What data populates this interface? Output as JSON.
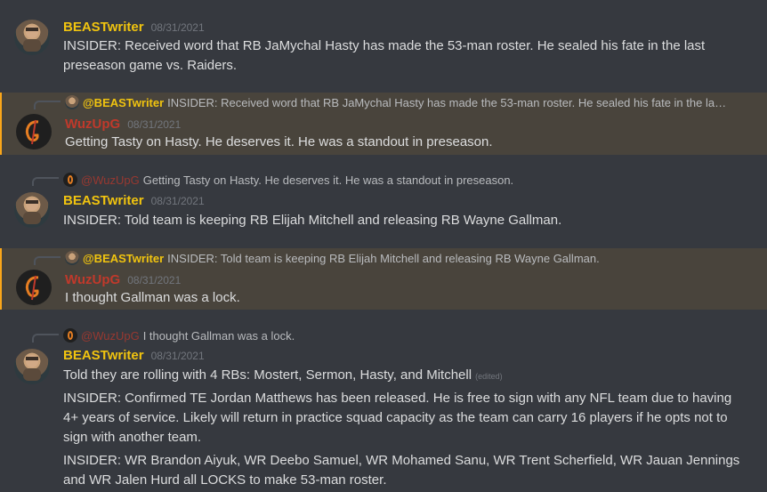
{
  "colors": {
    "background": "#36393f",
    "highlight": "#49443c",
    "highlight_border": "#faa61a",
    "beast_name": "#f1c40f",
    "wuz_name": "#c0392b",
    "timestamp": "#72767d"
  },
  "messages": [
    {
      "author": "BEASTwriter",
      "timestamp": "08/31/2021",
      "lines": [
        "INSIDER: Received word that RB JaMychal Hasty has made the 53-man roster. He sealed his fate in the last preseason game vs. Raiders."
      ]
    },
    {
      "reply_to": {
        "author": "@BEASTwriter",
        "text": "INSIDER: Received word that RB JaMychal Hasty has made the 53-man roster. He sealed his fate in the last p..."
      },
      "author": "WuzUpG",
      "timestamp": "08/31/2021",
      "lines": [
        "Getting Tasty on Hasty. He deserves it. He was a standout in preseason."
      ]
    },
    {
      "reply_to": {
        "author": "@WuzUpG",
        "text": "Getting Tasty on Hasty. He deserves it. He was a standout in preseason."
      },
      "author": "BEASTwriter",
      "timestamp": "08/31/2021",
      "lines": [
        "INSIDER: Told team is keeping RB Elijah Mitchell and releasing RB Wayne Gallman."
      ]
    },
    {
      "reply_to": {
        "author": "@BEASTwriter",
        "text": "INSIDER: Told team is keeping RB Elijah Mitchell and releasing RB Wayne Gallman."
      },
      "author": "WuzUpG",
      "timestamp": "08/31/2021",
      "lines": [
        "I thought Gallman was a lock."
      ]
    },
    {
      "reply_to": {
        "author": "@WuzUpG",
        "text": "I thought Gallman was a lock."
      },
      "author": "BEASTwriter",
      "timestamp": "08/31/2021",
      "lines": [
        "Told they are rolling with 4 RBs: Mostert, Sermon, Hasty, and Mitchell",
        "INSIDER: Confirmed TE Jordan Matthews has been released. He is free to sign with any NFL team due to having 4+ years of service. Likely will return in practice squad capacity as the team can carry 16 players if he opts not to sign with another team.",
        "INSIDER: WR Brandon Aiyuk, WR Deebo Samuel, WR Mohamed Sanu, WR Trent Scherfield, WR Jauan Jennings and WR Jalen Hurd all LOCKS to make 53-man roster."
      ],
      "edited_label": "(edited)"
    }
  ]
}
